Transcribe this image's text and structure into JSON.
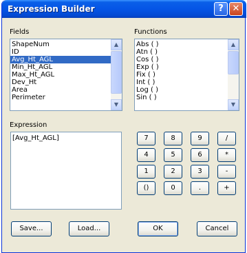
{
  "window": {
    "title": "Expression Builder",
    "help_glyph": "?",
    "close_glyph": "✕"
  },
  "fields": {
    "label": "Fields",
    "items": [
      "ShapeNum",
      "ID",
      "Avg_Ht_AGL",
      "Min_Ht_AGL",
      "Max_Ht_AGL",
      "Dev_Ht",
      "Area",
      "Perimeter"
    ],
    "selected": "Avg_Ht_AGL"
  },
  "functions": {
    "label": "Functions",
    "items": [
      "Abs ( )",
      "Atn ( )",
      "Cos ( )",
      "Exp ( )",
      "Fix ( )",
      "Int ( )",
      "Log ( )",
      "Sin ( )"
    ]
  },
  "expression": {
    "label": "Expression",
    "value": "[Avg_Ht_AGL]"
  },
  "keypad": [
    [
      "7",
      "8",
      "9",
      "/"
    ],
    [
      "4",
      "5",
      "6",
      "*"
    ],
    [
      "1",
      "2",
      "3",
      "-"
    ],
    [
      "()",
      "0",
      ".",
      "+"
    ]
  ],
  "buttons": {
    "save": "Save...",
    "load": "Load...",
    "ok": "OK",
    "cancel": "Cancel"
  },
  "scroll_arrows": {
    "up": "▲",
    "down": "▼"
  }
}
